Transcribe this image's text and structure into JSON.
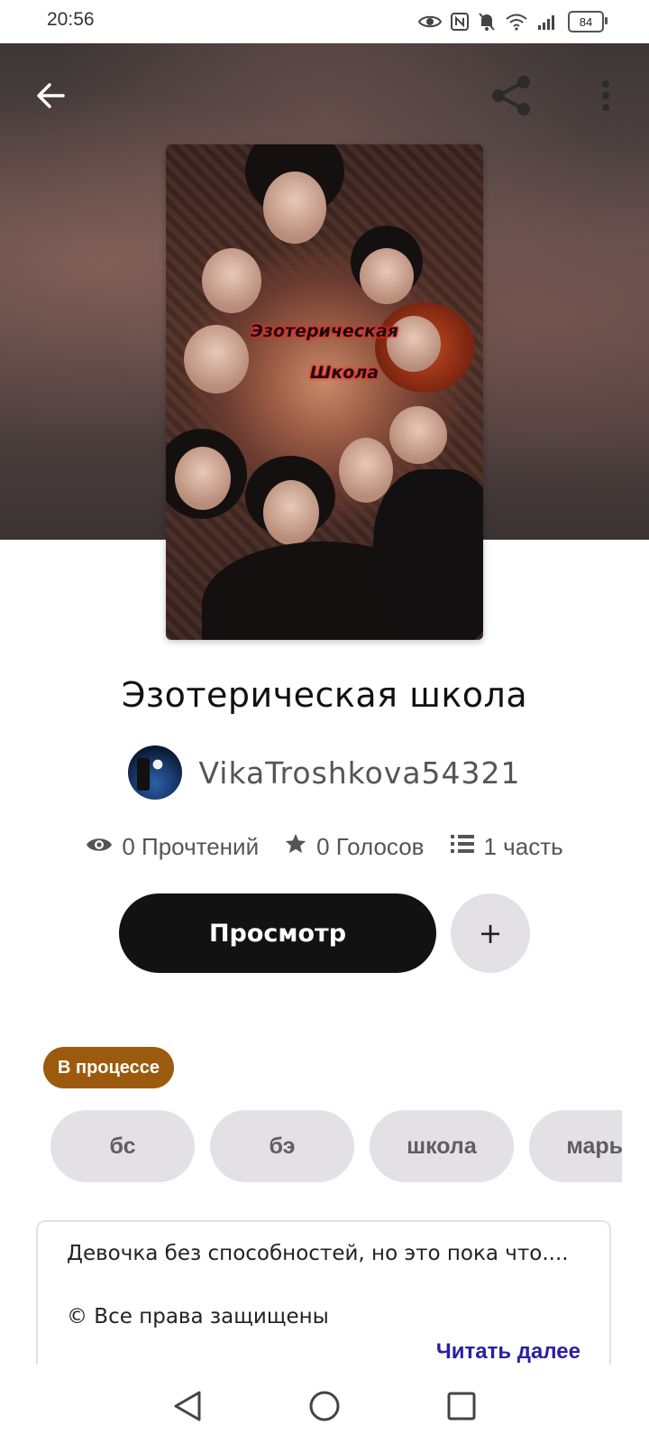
{
  "status_bar": {
    "time": "20:56",
    "battery": "84",
    "icons": [
      "eye-icon",
      "nfc-icon",
      "bell-off-icon",
      "wifi-icon",
      "signal-icon",
      "battery-icon"
    ]
  },
  "header": {
    "back_icon": "arrow-left-icon",
    "share_icon": "share-icon",
    "menu_icon": "more-vertical-icon"
  },
  "cover": {
    "text_line1": "Эзотерическая",
    "text_line2": "Школа"
  },
  "story": {
    "title": "Эзотерическая школа",
    "author": "VikaTroshkova54321",
    "reads": "0 Прочтений",
    "votes": "0 Голосов",
    "parts": "1 часть"
  },
  "actions": {
    "read_label": "Просмотр",
    "add_label": "+"
  },
  "status_badge": "В процессе",
  "tags": [
    "бс",
    "бэ",
    "школа",
    "марья"
  ],
  "description": {
    "text": "Девочка без способностей, но это пока что....",
    "copyright": "© Все права защищены",
    "read_more": "Читать далее"
  },
  "colors": {
    "primary_button": "#121212",
    "badge": "#9c5a0e",
    "tag_bg": "#e3e1e6",
    "link": "#2a1fa0"
  }
}
